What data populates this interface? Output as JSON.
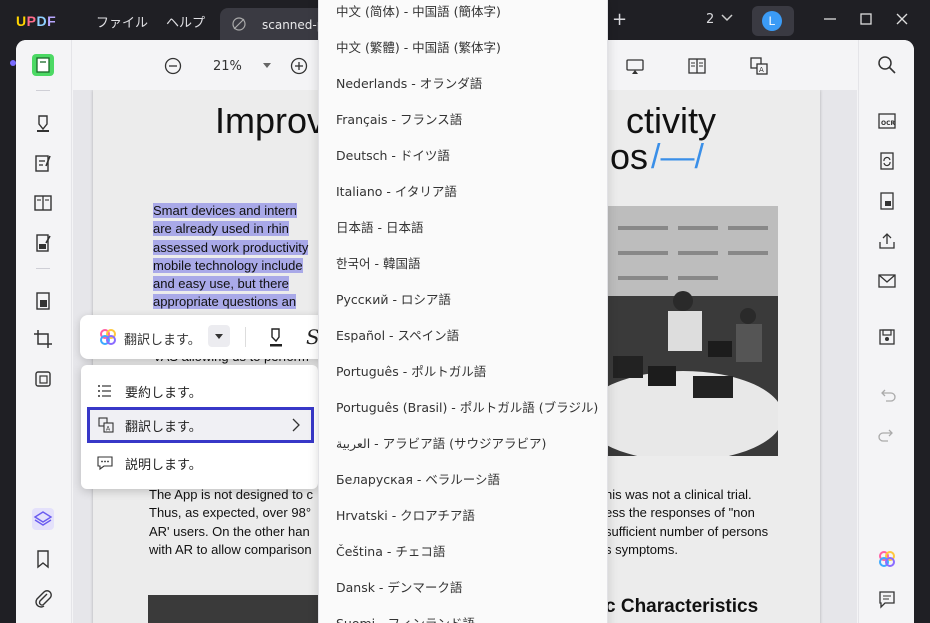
{
  "app": {
    "logo": "UPDF",
    "menu_file": "ファイル",
    "menu_help": "ヘルプ",
    "tab_title": "scanned-p",
    "page_count": "2",
    "avatar_initial": "L",
    "accent_color": "#3838c8"
  },
  "toolbar": {
    "zoom": "21%"
  },
  "document": {
    "title_left": "Improv",
    "title_right": "ctivity",
    "title_line2": "os",
    "slash_art": "/—/",
    "para1_lines": [
      "Smart devices and intern",
      "are already used in rhin",
      "assessed work productivity",
      "mobile technology include",
      "and easy use, but there",
      "appropriate questions an"
    ],
    "para1_tail": "VAS allowing us to perform",
    "para2_left_lines": [
      "The App is not designed to c",
      "Thus, as expected, over 98°",
      "AR' users. On the other han",
      "with AR to allow comparison"
    ],
    "para2_right_lines": [
      "his was not a clinical trial.",
      "ess the responses of \"non",
      "sufficient number of persons",
      "s symptoms."
    ],
    "subheading": "c Characteristics"
  },
  "float_toolbar": {
    "translate_label": "翻訳します。"
  },
  "context_menu": {
    "items": [
      {
        "label": "要約します。",
        "icon": "list-icon"
      },
      {
        "label": "翻訳します。",
        "icon": "translate-icon"
      },
      {
        "label": "説明します。",
        "icon": "explain-icon"
      }
    ]
  },
  "languages": [
    "中文 (简体) - 中国語 (簡体字)",
    "中文 (繁體) - 中国語 (繁体字)",
    "Nederlands - オランダ語",
    "Français - フランス語",
    "Deutsch - ドイツ語",
    "Italiano - イタリア語",
    "日本語 - 日本語",
    "한국어 - 韓国語",
    "Русский - ロシア語",
    "Español - スペイン語",
    "Português - ポルトガル語",
    "Português (Brasil) - ポルトガル語 (ブラジル)",
    "العربية - アラビア語 (サウジアラビア)",
    "Беларуская - ベラルーシ語",
    "Hrvatski - クロアチア語",
    "Čeština - チェコ語",
    "Dansk - デンマーク語",
    "Suomi - フィンランド語"
  ]
}
